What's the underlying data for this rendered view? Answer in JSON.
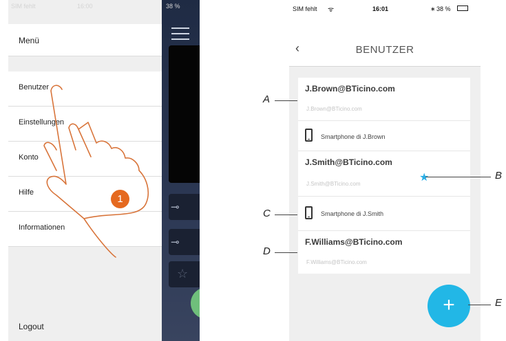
{
  "left_phone": {
    "status": {
      "carrier": "SIM fehlt",
      "time": "16:00",
      "battery": "38 %"
    },
    "menu": {
      "header": "Menü",
      "items": [
        {
          "label": "Benutzer"
        },
        {
          "label": "Einstellungen"
        },
        {
          "label": "Konto"
        },
        {
          "label": "Hilfe"
        },
        {
          "label": "Informationen"
        }
      ],
      "logout": "Logout"
    },
    "step_badge": "1"
  },
  "right_phone": {
    "status": {
      "carrier": "SIM fehlt",
      "time": "16:01",
      "battery": "38 %"
    },
    "back_icon": "chevron-left-icon",
    "title": "BENUTZER",
    "users": [
      {
        "email": "J.Brown@BTicino.com",
        "sub": "J.Brown@BTicino.com",
        "device": "Smartphone di J.Brown"
      },
      {
        "email": "J.Smith@BTicino.com",
        "sub": "J.Smith@BTicino.com",
        "device": "Smartphone di J.Smith"
      },
      {
        "email": "F.Williams@BTicino.com",
        "sub": "F.Williams@BTicino.com"
      }
    ],
    "fab_label": "+",
    "accent": "#22b7e6"
  },
  "callouts": {
    "a": "A",
    "b": "B",
    "c": "C",
    "d": "D",
    "e": "E"
  }
}
